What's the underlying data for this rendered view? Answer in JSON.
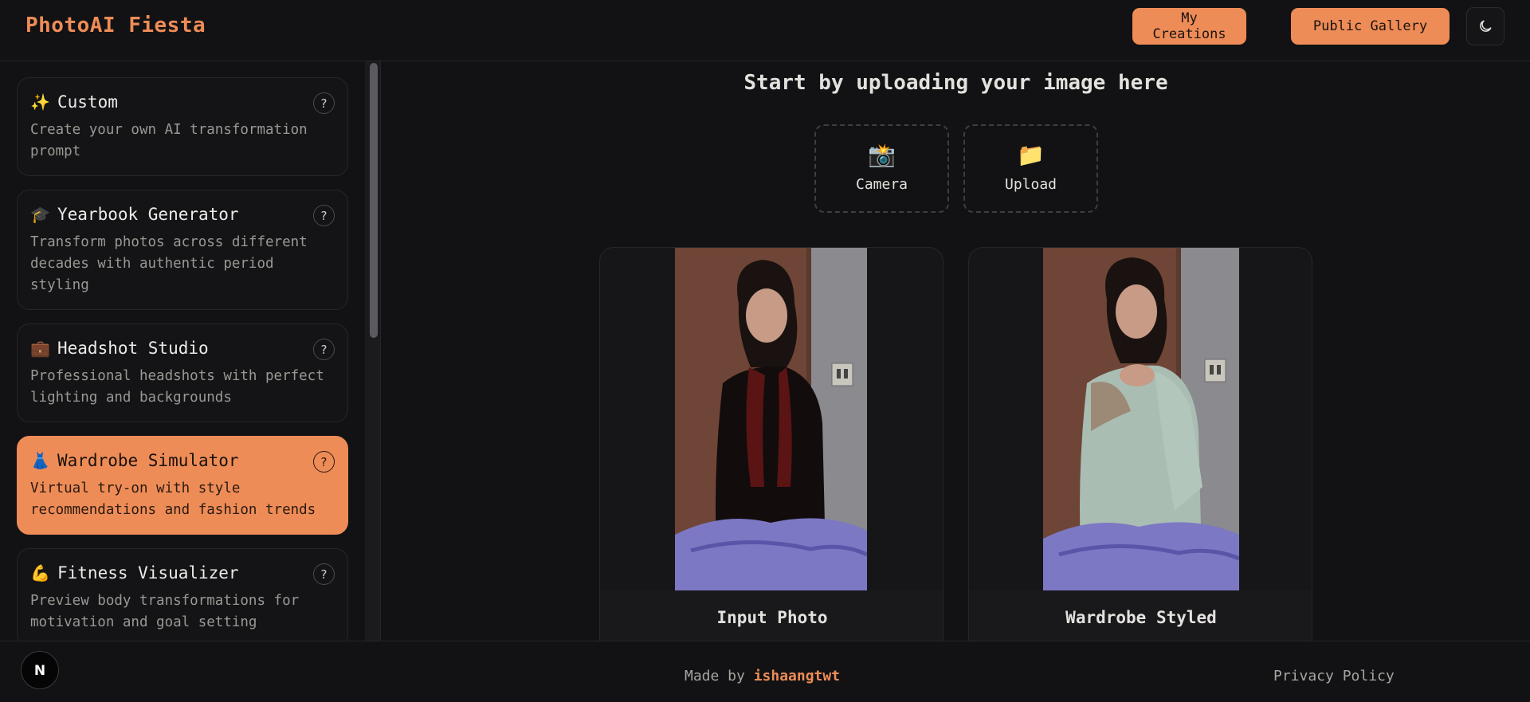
{
  "header": {
    "brand": "PhotoAI Fiesta",
    "my_creations": "My Creations",
    "public_gallery": "Public Gallery",
    "theme_icon": "moon-icon"
  },
  "sidebar": {
    "items": [
      {
        "icon": "sparkles-icon",
        "emoji": "✨",
        "title": "Custom",
        "desc": "Create your own AI transformation prompt",
        "active": false
      },
      {
        "icon": "graduation-cap-icon",
        "emoji": "🎓",
        "title": "Yearbook Generator",
        "desc": "Transform photos across different decades with authentic period styling",
        "active": false
      },
      {
        "icon": "briefcase-icon",
        "emoji": "💼",
        "title": "Headshot Studio",
        "desc": "Professional headshots with perfect lighting and backgrounds",
        "active": false
      },
      {
        "icon": "dress-icon",
        "emoji": "👗",
        "title": "Wardrobe Simulator",
        "desc": "Virtual try-on with style recommendations and fashion trends",
        "active": true
      },
      {
        "icon": "flexed-biceps-icon",
        "emoji": "💪",
        "title": "Fitness Visualizer",
        "desc": "Preview body transformations for motivation and goal setting",
        "active": false
      }
    ],
    "help_label": "?"
  },
  "main": {
    "title": "Start by uploading your image here",
    "camera_label": "Camera",
    "camera_icon": "camera-flash-icon",
    "upload_label": "Upload",
    "upload_icon": "folder-icon",
    "input_caption": "Input Photo",
    "output_caption": "Wardrobe Styled"
  },
  "footer": {
    "made_by_prefix": "Made by",
    "author": "ishaangtwt",
    "privacy": "Privacy Policy",
    "badge_letter": "N"
  },
  "colors": {
    "accent": "#ee8c57",
    "background": "#121214",
    "border": "#26262a"
  }
}
